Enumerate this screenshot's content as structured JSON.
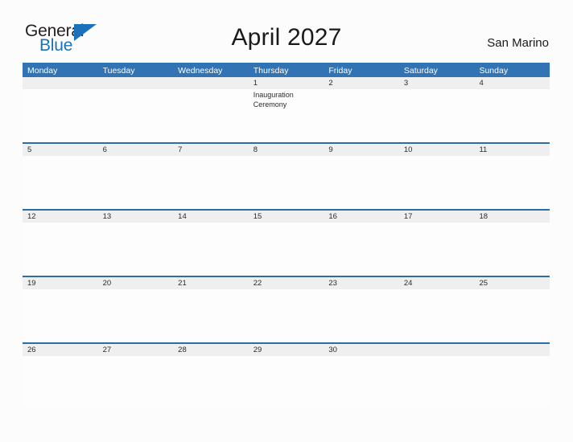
{
  "brand": {
    "name_line1": "General",
    "name_line2": "Blue",
    "accent_color": "#1b72bb",
    "triangle_icon": "triangle-icon"
  },
  "header": {
    "title": "April 2027",
    "subtitle": "San Marino"
  },
  "calendar": {
    "header_color": "#3273b4",
    "row_divider_color": "#2e6da4",
    "day_band_color": "#efefef",
    "weekdays": [
      "Monday",
      "Tuesday",
      "Wednesday",
      "Thursday",
      "Friday",
      "Saturday",
      "Sunday"
    ],
    "weeks": [
      [
        {
          "day": "",
          "events": []
        },
        {
          "day": "",
          "events": []
        },
        {
          "day": "",
          "events": []
        },
        {
          "day": "1",
          "events": [
            "Inauguration Ceremony"
          ]
        },
        {
          "day": "2",
          "events": []
        },
        {
          "day": "3",
          "events": []
        },
        {
          "day": "4",
          "events": []
        }
      ],
      [
        {
          "day": "5",
          "events": []
        },
        {
          "day": "6",
          "events": []
        },
        {
          "day": "7",
          "events": []
        },
        {
          "day": "8",
          "events": []
        },
        {
          "day": "9",
          "events": []
        },
        {
          "day": "10",
          "events": []
        },
        {
          "day": "11",
          "events": []
        }
      ],
      [
        {
          "day": "12",
          "events": []
        },
        {
          "day": "13",
          "events": []
        },
        {
          "day": "14",
          "events": []
        },
        {
          "day": "15",
          "events": []
        },
        {
          "day": "16",
          "events": []
        },
        {
          "day": "17",
          "events": []
        },
        {
          "day": "18",
          "events": []
        }
      ],
      [
        {
          "day": "19",
          "events": []
        },
        {
          "day": "20",
          "events": []
        },
        {
          "day": "21",
          "events": []
        },
        {
          "day": "22",
          "events": []
        },
        {
          "day": "23",
          "events": []
        },
        {
          "day": "24",
          "events": []
        },
        {
          "day": "25",
          "events": []
        }
      ],
      [
        {
          "day": "26",
          "events": []
        },
        {
          "day": "27",
          "events": []
        },
        {
          "day": "28",
          "events": []
        },
        {
          "day": "29",
          "events": []
        },
        {
          "day": "30",
          "events": []
        },
        {
          "day": "",
          "events": []
        },
        {
          "day": "",
          "events": []
        }
      ]
    ]
  }
}
